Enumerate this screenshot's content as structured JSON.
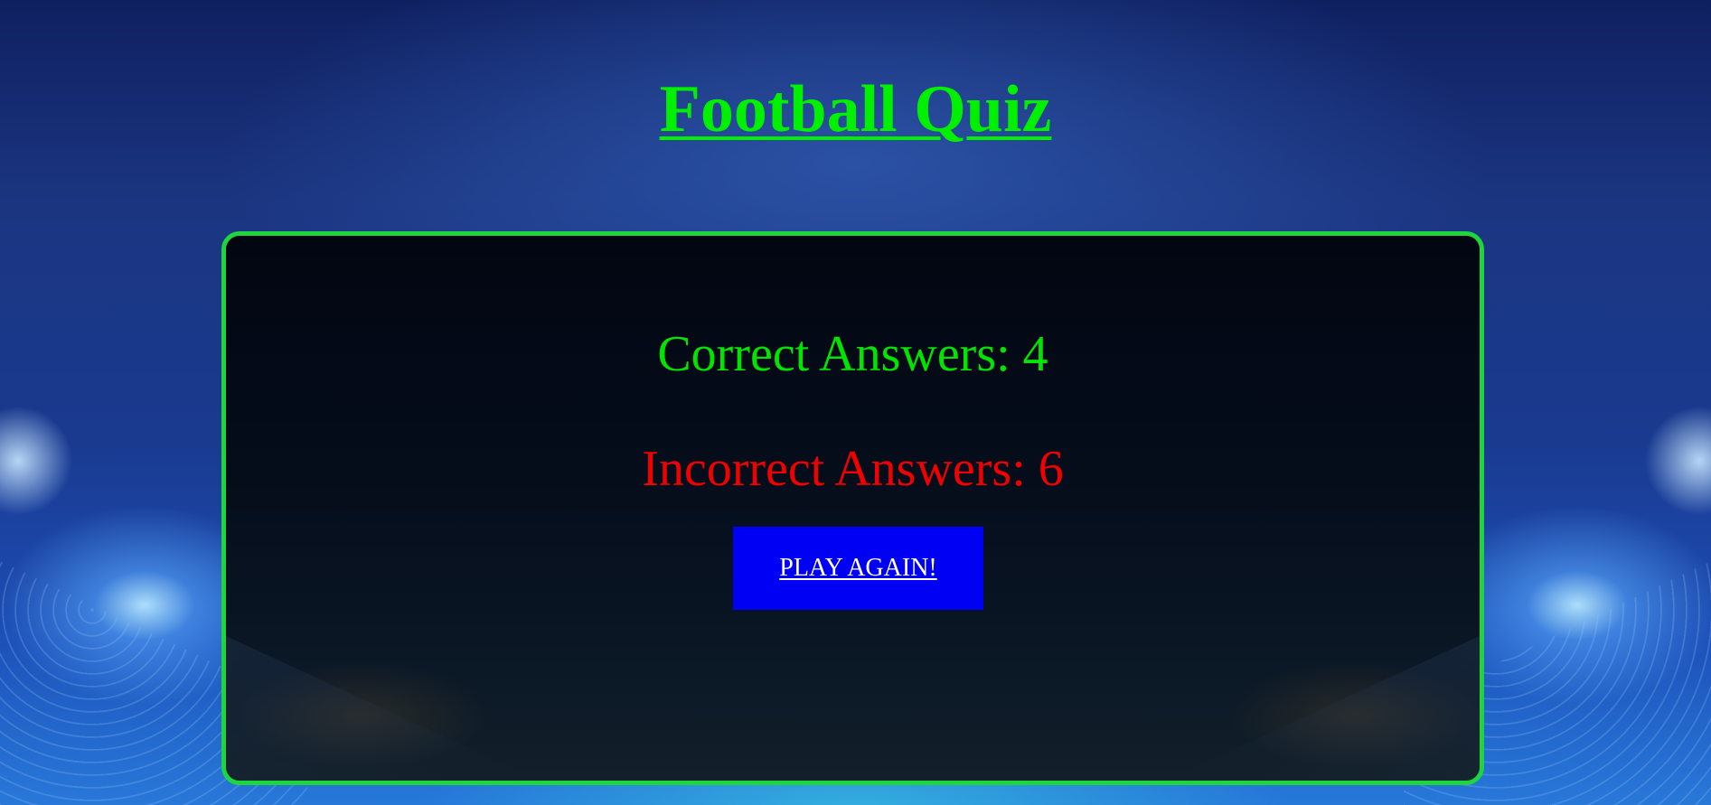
{
  "page": {
    "title": "Football Quiz"
  },
  "results": {
    "correct_label": "Correct Answers: 4",
    "incorrect_label": "Incorrect Answers: 6",
    "correct_count": 4,
    "incorrect_count": 6
  },
  "actions": {
    "play_again_label": "PLAY AGAIN!"
  },
  "colors": {
    "title": "#00f000",
    "panel_border": "#1fd53f",
    "correct": "#00e400",
    "incorrect": "#f00000",
    "button_bg": "#0000f5",
    "button_text": "#ffffff"
  }
}
